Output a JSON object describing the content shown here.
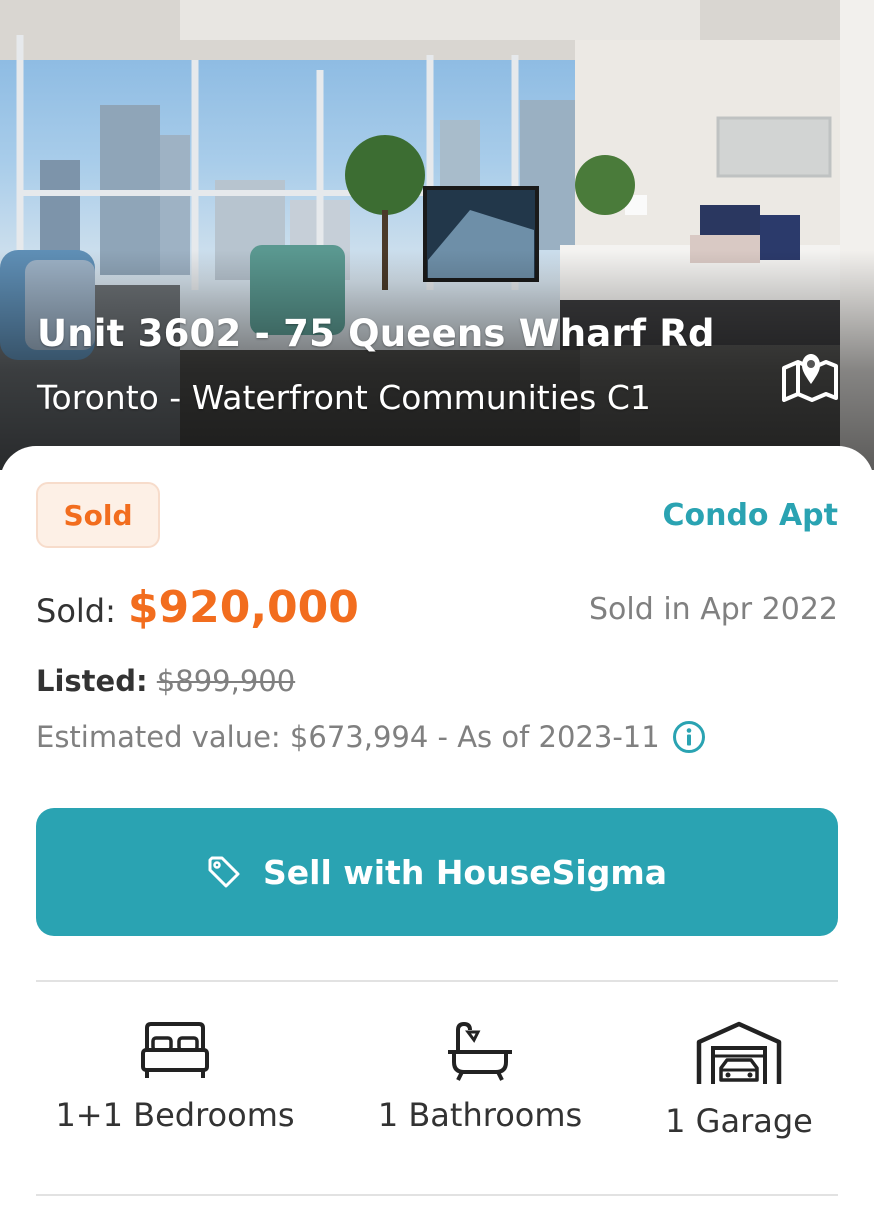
{
  "listing": {
    "address": "Unit 3602 - 75 Queens Wharf Rd",
    "area": "Toronto - Waterfront Communities C1",
    "status": "Sold",
    "property_type": "Condo Apt",
    "sold_label": "Sold:",
    "sold_price": "$920,000",
    "sold_date": "Sold in Apr 2022",
    "listed_label": "Listed:",
    "listed_price": "$899,900",
    "estimate_text": "Estimated value: $673,994 - As of 2023-11"
  },
  "cta": {
    "label": "Sell with HouseSigma",
    "icon": "tag-icon"
  },
  "features": [
    {
      "label": "1+1 Bedrooms",
      "icon": "bed-icon"
    },
    {
      "label": "1 Bathrooms",
      "icon": "bathtub-icon"
    },
    {
      "label": "1 Garage",
      "icon": "garage-icon"
    }
  ],
  "icons": {
    "map": "map-pin-icon",
    "info": "info-icon"
  },
  "colors": {
    "accent_teal": "#2aa3b2",
    "sold_orange": "#f26d1e",
    "badge_bg": "#fdf0e6"
  }
}
